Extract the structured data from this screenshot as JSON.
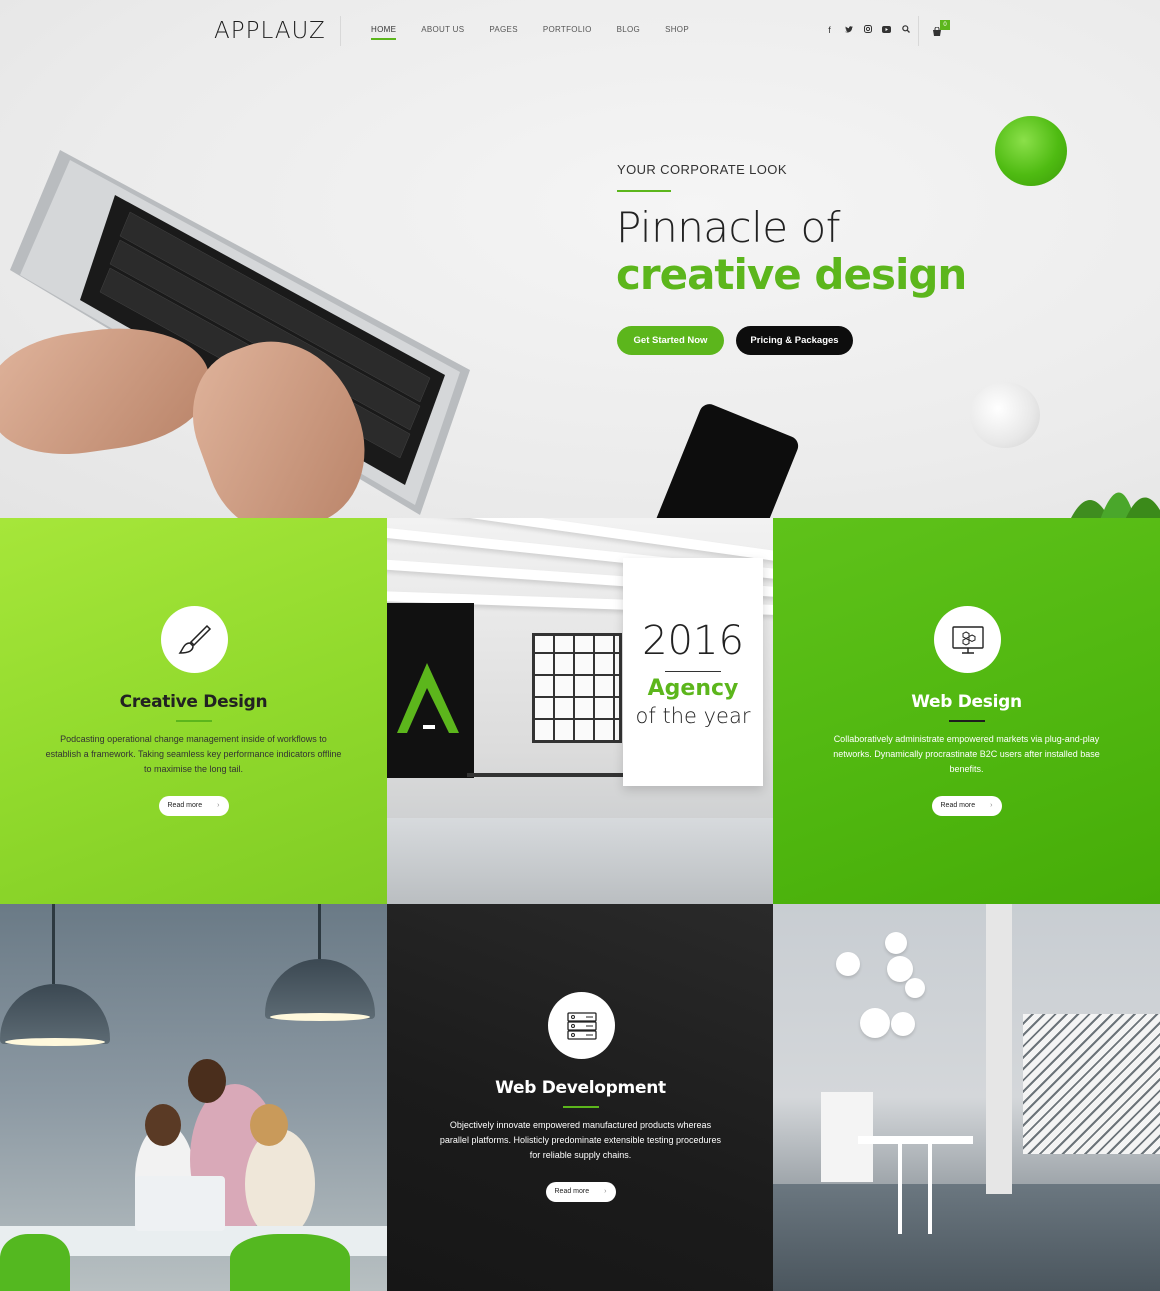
{
  "header": {
    "logo": "APPLAUZ",
    "nav": [
      "HOME",
      "ABOUT US",
      "PAGES",
      "PORTFOLIO",
      "BLOG",
      "SHOP"
    ],
    "social_icons": [
      "facebook-icon",
      "twitter-icon",
      "instagram-icon",
      "youtube-icon",
      "search-icon"
    ],
    "cart_count": "0"
  },
  "hero": {
    "eyebrow": "YOUR CORPORATE LOOK",
    "title_line1": "Pinnacle of",
    "title_line2": "creative design",
    "primary_button": "Get Started Now",
    "secondary_button": "Pricing & Packages"
  },
  "tiles": {
    "creative": {
      "title": "Creative Design",
      "text": "Podcasting operational change management inside of workflows to establish a framework. Taking seamless key performance indicators offline to maximise the long tail.",
      "button": "Read more",
      "icon": "paintbrush-icon"
    },
    "office": {
      "year": "2016",
      "agency": "Agency",
      "of_year": "of the year"
    },
    "web_design": {
      "title": "Web Design",
      "text": "Collaboratively administrate empowered markets via plug-and-play networks. Dynamically procrastinate B2C users after installed base benefits.",
      "button": "Read more",
      "icon": "monitor-icon"
    },
    "web_dev": {
      "title": "Web Development",
      "text": "Objectively innovate empowered manufactured products whereas parallel platforms. Holisticly predominate extensible testing procedures for reliable supply chains.",
      "button": "Read more",
      "icon": "server-icon"
    }
  },
  "colors": {
    "accent": "#5cb61c",
    "dark": "#0d0d0d"
  }
}
